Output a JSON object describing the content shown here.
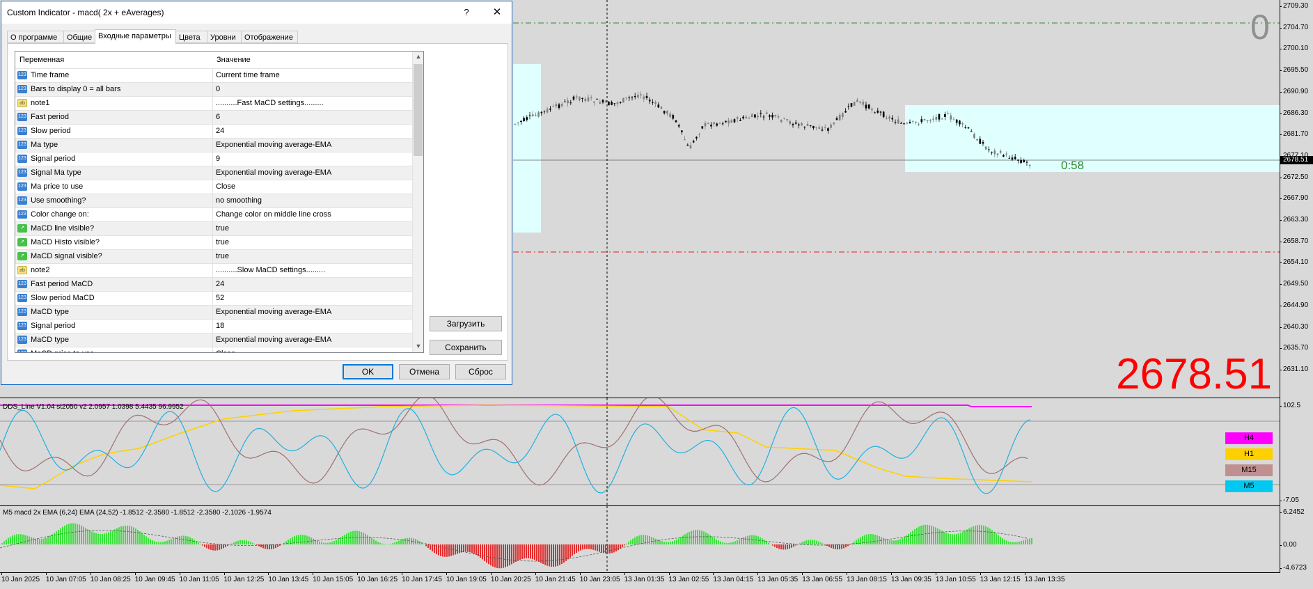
{
  "dialog": {
    "title": "Custom Indicator - macd( 2x + eAverages)",
    "help_label": "?",
    "close_label": "✕",
    "tabs": [
      {
        "label": "О программе"
      },
      {
        "label": "Общие"
      },
      {
        "label": "Входные параметры"
      },
      {
        "label": "Цвета"
      },
      {
        "label": "Уровни"
      },
      {
        "label": "Отображение"
      }
    ],
    "active_tab": 2,
    "grid": {
      "col_variable": "Переменная",
      "col_value": "Значение",
      "rows": [
        {
          "icon": "123",
          "name": "Time frame",
          "value": "Current time frame"
        },
        {
          "icon": "123",
          "name": "Bars to display 0 = all bars",
          "value": "0"
        },
        {
          "icon": "ab",
          "name": "note1",
          "value": "..........Fast MaCD settings........."
        },
        {
          "icon": "123",
          "name": "Fast period",
          "value": "6"
        },
        {
          "icon": "123",
          "name": "Slow period",
          "value": "24"
        },
        {
          "icon": "123",
          "name": "Ma type",
          "value": "Exponential moving average-EMA"
        },
        {
          "icon": "123",
          "name": "Signal  period",
          "value": "9"
        },
        {
          "icon": "123",
          "name": "Signal Ma type",
          "value": "Exponential moving average-EMA"
        },
        {
          "icon": "123",
          "name": "Ma price to use",
          "value": "Close"
        },
        {
          "icon": "123",
          "name": "Use smoothing?",
          "value": "no smoothing"
        },
        {
          "icon": "123",
          "name": "Color change on:",
          "value": "Change color on middle line cross"
        },
        {
          "icon": "color",
          "name": "MaCD line visible?",
          "value": "true"
        },
        {
          "icon": "color",
          "name": "MaCD Histo visible?",
          "value": "true"
        },
        {
          "icon": "color",
          "name": "MaCD signal visible?",
          "value": "true"
        },
        {
          "icon": "ab",
          "name": "note2",
          "value": "..........Slow MaCD settings........."
        },
        {
          "icon": "123",
          "name": "Fast period MaCD",
          "value": "24"
        },
        {
          "icon": "123",
          "name": "Slow period MaCD",
          "value": "52"
        },
        {
          "icon": "123",
          "name": "MaCD type",
          "value": "Exponential moving average-EMA"
        },
        {
          "icon": "123",
          "name": "Signal  period",
          "value": "18"
        },
        {
          "icon": "123",
          "name": "MaCD type",
          "value": "Exponential moving average-EMA"
        },
        {
          "icon": "123",
          "name": "MaCD price to use",
          "value": "Close"
        }
      ]
    },
    "load_button": "Загрузить",
    "save_button": "Сохранить",
    "ok_button": "OK",
    "cancel_button": "Отмена",
    "reset_button": "Сброс"
  },
  "chart": {
    "corner_zero": "0",
    "countdown": "0:58",
    "big_price": "2678.51",
    "current_price_label": "2678.51",
    "price_axis": [
      "2709.30",
      "2704.70",
      "2700.10",
      "2695.50",
      "2690.90",
      "2686.30",
      "2681.70",
      "2677.10",
      "2672.50",
      "2667.90",
      "2663.30",
      "2658.70",
      "2654.10",
      "2649.50",
      "2644.90",
      "2640.30",
      "2635.70",
      "2631.10"
    ],
    "dds_title": "DDS_Line V1.04 st2050 v2 2.0957 1.0398 5.4435 96.9952",
    "dds_axis_top": "102.5",
    "dds_axis_bottom": "-7.05",
    "dds_badges": [
      {
        "label": "H4",
        "color": "#ff00ff"
      },
      {
        "label": "H1",
        "color": "#ffd000"
      },
      {
        "label": "M15",
        "color": "#c09090"
      },
      {
        "label": "M5",
        "color": "#00c8f0"
      }
    ],
    "macd_title": "M5 macd 2x EMA (6,24) EMA (24,52)  -1.8512 -2.3580 -1.8512 -2.3580 -2.1026 -1.9574",
    "macd_axis": [
      "6.2452",
      "0.00",
      "-4.6723"
    ],
    "time_axis": [
      "10 Jan 2025",
      "10 Jan 07:05",
      "10 Jan 08:25",
      "10 Jan 09:45",
      "10 Jan 11:05",
      "10 Jan 12:25",
      "10 Jan 13:45",
      "10 Jan 15:05",
      "10 Jan 16:25",
      "10 Jan 17:45",
      "10 Jan 19:05",
      "10 Jan 20:25",
      "10 Jan 21:45",
      "10 Jan 23:05",
      "13 Jan 01:35",
      "13 Jan 02:55",
      "13 Jan 04:15",
      "13 Jan 05:35",
      "13 Jan 06:55",
      "13 Jan 08:15",
      "13 Jan 09:35",
      "13 Jan 10:55",
      "13 Jan 12:15",
      "13 Jan 13:35"
    ]
  },
  "colors": {
    "bull_candle": "#000000",
    "bear_candle": "#808080",
    "zone": "#e0ffff",
    "upper_level": "#2e8b2e",
    "lower_level": "#e02020",
    "big_price": "#ff0000",
    "macd_up": "#40e040",
    "macd_down": "#e03030"
  }
}
